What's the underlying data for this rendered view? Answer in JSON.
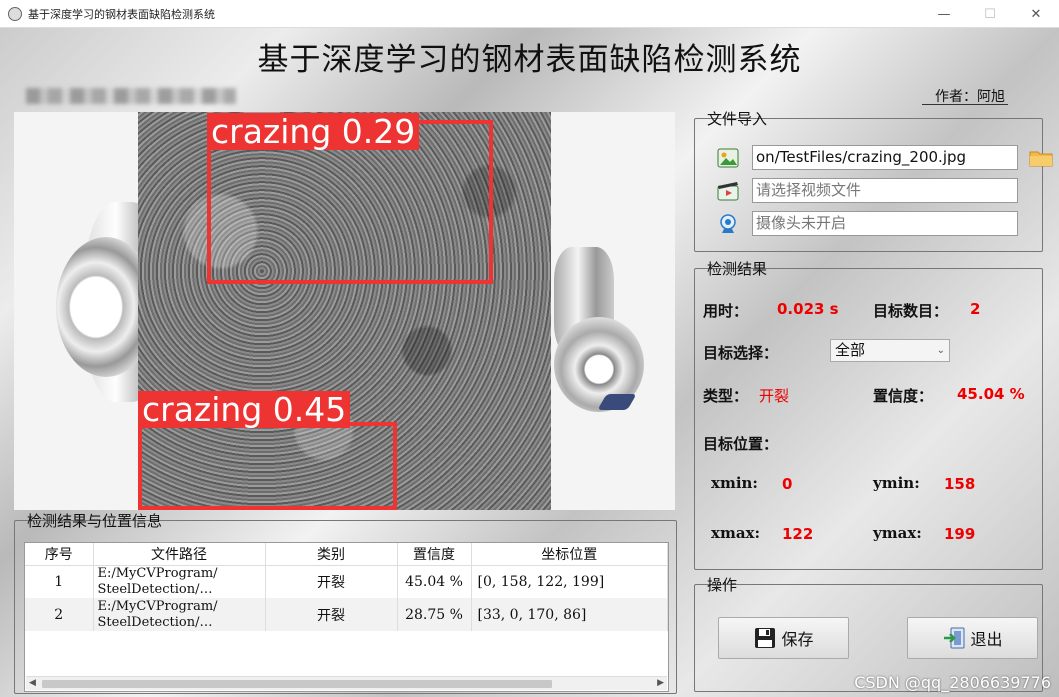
{
  "window": {
    "title": "基于深度学习的钢材表面缺陷检测系统",
    "controls": [
      "—",
      "☐",
      "✕"
    ]
  },
  "header": {
    "title": "基于深度学习的钢材表面缺陷检测系统",
    "author": "作者：阿旭"
  },
  "image": {
    "detections": [
      {
        "label": "crazing 0.29"
      },
      {
        "label": "crazing 0.45"
      }
    ]
  },
  "results": {
    "group_title": "检测结果与位置信息",
    "columns": [
      "序号",
      "文件路径",
      "类别",
      "置信度",
      "坐标位置"
    ],
    "rows": [
      {
        "no": "1",
        "path1": "E:/MyCVProgram/",
        "path2": "SteelDetection/…",
        "cls": "开裂",
        "conf": "45.04 %",
        "coords": "[0, 158, 122, 199]"
      },
      {
        "no": "2",
        "path1": "E:/MyCVProgram/",
        "path2": "SteelDetection/…",
        "cls": "开裂",
        "conf": "28.75 %",
        "coords": "[33, 0, 170, 86]"
      }
    ]
  },
  "file_import": {
    "title": "文件导入",
    "image_path": "on/TestFiles/crazing_200.jpg",
    "video_placeholder": "请选择视频文件",
    "camera_placeholder": "摄像头未开启",
    "icons": [
      "image-file-icon",
      "video-file-icon",
      "camera-icon",
      "folder-icon"
    ]
  },
  "detection": {
    "title": "检测结果",
    "time_label": "用时：",
    "time_value": "0.023 s",
    "count_label": "目标数目：",
    "count_value": "2",
    "select_label": "目标选择：",
    "select_value": "全部",
    "type_label": "类型：",
    "type_value": "开裂",
    "conf_label": "置信度：",
    "conf_value": "45.04 %",
    "pos_label": "目标位置：",
    "xmin_label": "xmin:",
    "xmin": "0",
    "ymin_label": "ymin:",
    "ymin": "158",
    "xmax_label": "xmax:",
    "xmax": "122",
    "ymax_label": "ymax:",
    "ymax": "199"
  },
  "operations": {
    "title": "操作",
    "save_label": "保存",
    "exit_label": "退出"
  },
  "watermark": "CSDN @qq_2806639776",
  "colors": {
    "detection_red": "#ee3333",
    "value_red": "#e00000"
  }
}
